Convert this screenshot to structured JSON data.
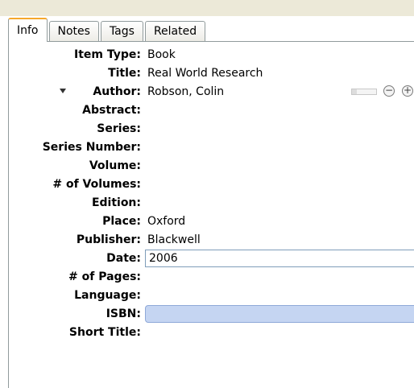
{
  "tabs": [
    {
      "label": "Info"
    },
    {
      "label": "Notes"
    },
    {
      "label": "Tags"
    },
    {
      "label": "Related"
    }
  ],
  "fields": {
    "item_type": {
      "label": "Item Type:",
      "value": "Book"
    },
    "title": {
      "label": "Title:",
      "value": "Real World Research"
    },
    "author": {
      "label": "Author:",
      "value": "Robson, Colin"
    },
    "abstract": {
      "label": "Abstract:",
      "value": ""
    },
    "series": {
      "label": "Series:",
      "value": ""
    },
    "series_number": {
      "label": "Series Number:",
      "value": ""
    },
    "volume": {
      "label": "Volume:",
      "value": ""
    },
    "num_volumes": {
      "label": "# of Volumes:",
      "value": ""
    },
    "edition": {
      "label": "Edition:",
      "value": ""
    },
    "place": {
      "label": "Place:",
      "value": "Oxford"
    },
    "publisher": {
      "label": "Publisher:",
      "value": "Blackwell"
    },
    "date": {
      "label": "Date:",
      "value": "2006"
    },
    "num_pages": {
      "label": "# of Pages:",
      "value": ""
    },
    "language": {
      "label": "Language:",
      "value": ""
    },
    "isbn": {
      "label": "ISBN:",
      "value": ""
    },
    "short_title": {
      "label": "Short Title:",
      "value": ""
    }
  },
  "icons": {
    "author_expand": "chevron-down-icon",
    "remove_author": "minus-circle-icon",
    "add_author": "plus-circle-icon"
  }
}
